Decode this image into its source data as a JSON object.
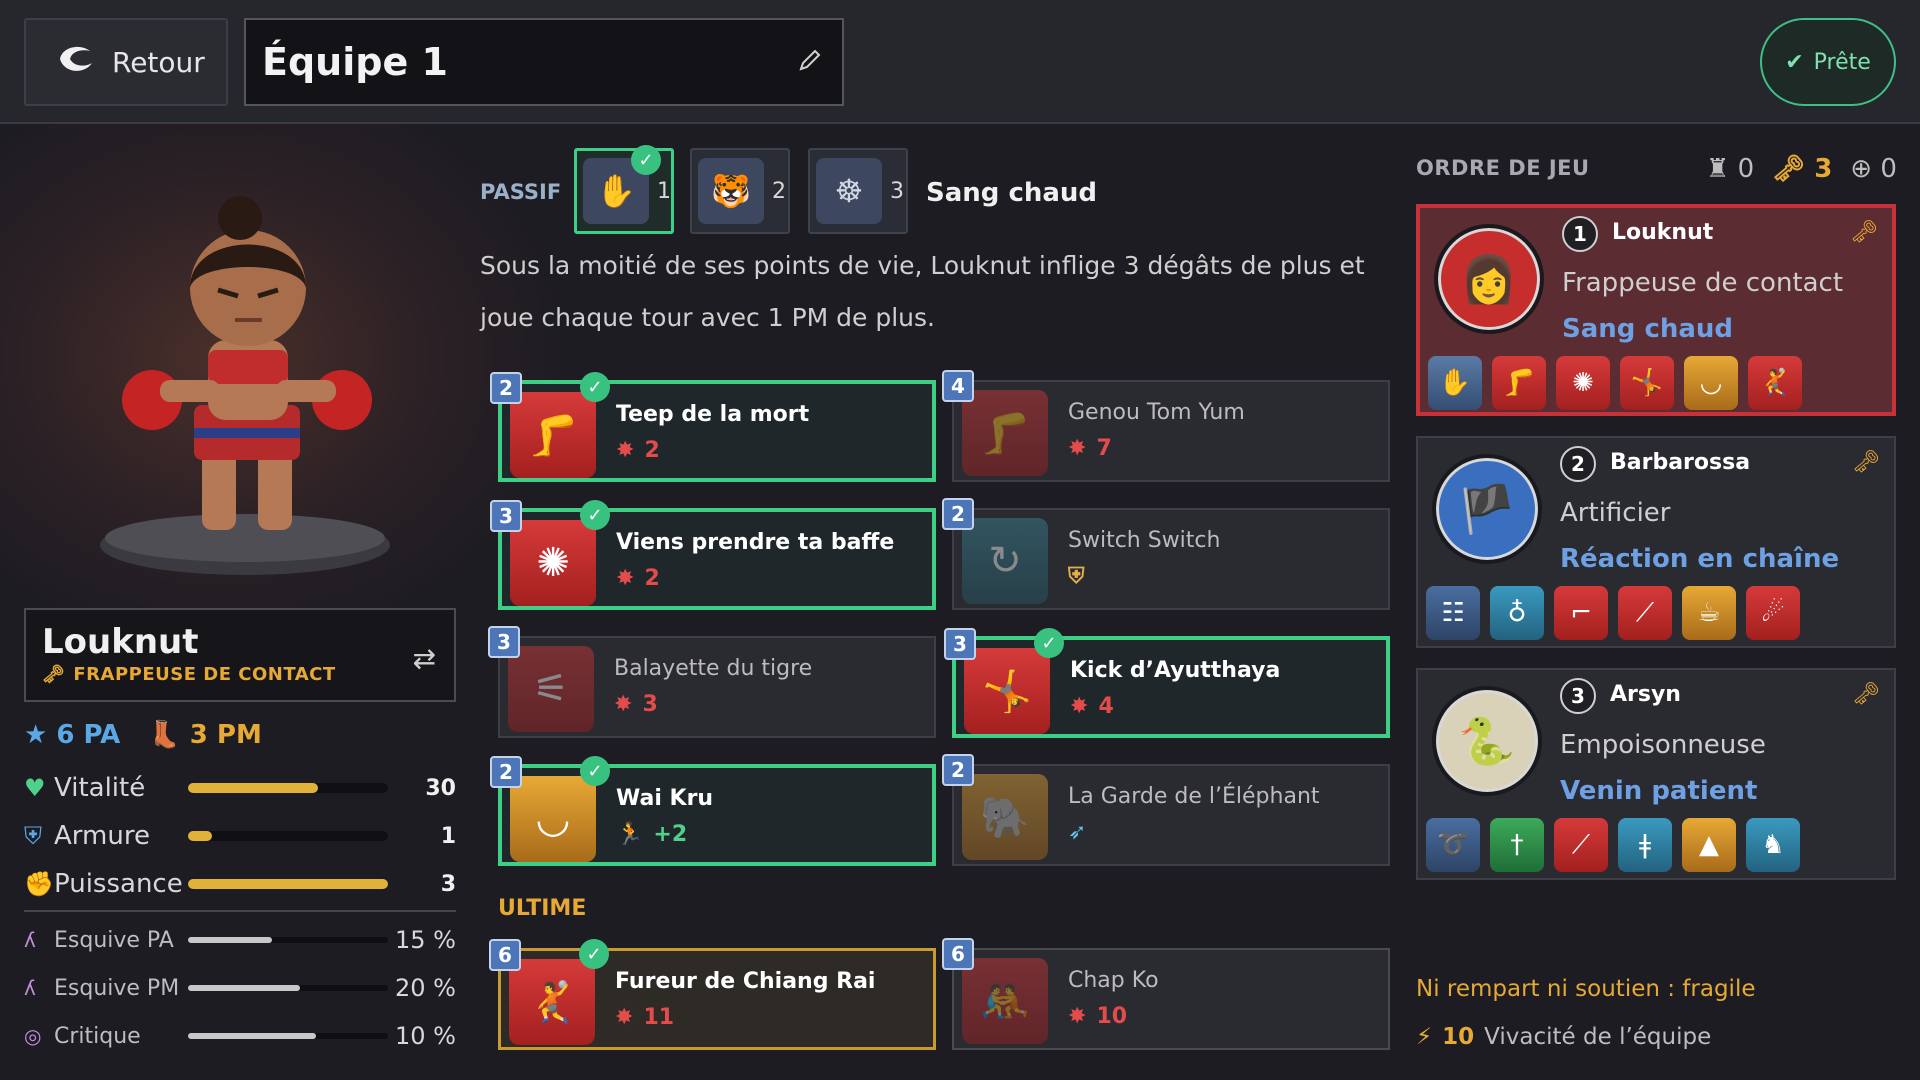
{
  "topbar": {
    "back_label": "Retour",
    "team_name": "Équipe 1",
    "ready_label": "Prête"
  },
  "character": {
    "name": "Louknut",
    "role": "FRAPPEUSE DE CONTACT",
    "pa": "6 PA",
    "pm": "3 PM",
    "stats": [
      {
        "label": "Vitalité",
        "value": "30",
        "level": 0.65,
        "color": "#4fd08d"
      },
      {
        "label": "Armure",
        "value": "1",
        "level": 0.12,
        "color": "#5aa8e6"
      },
      {
        "label": "Puissance",
        "value": "3",
        "level": 1.0,
        "color": "#e44c4c"
      }
    ],
    "substats": [
      {
        "label": "Esquive PA",
        "value": "15 %",
        "level": 0.42
      },
      {
        "label": "Esquive PM",
        "value": "20 %",
        "level": 0.56
      },
      {
        "label": "Critique",
        "value": "10 %",
        "level": 0.64
      }
    ]
  },
  "passive": {
    "label": "PASSIF",
    "options": [
      {
        "num": "1",
        "icon": "fist-wrap-icon"
      },
      {
        "num": "2",
        "icon": "tiger-icon"
      },
      {
        "num": "3",
        "icon": "octopus-icon"
      }
    ],
    "title": "Sang chaud",
    "description": "Sous la moitié de ses points de vie, Louknut inflige 3 dégâts de plus et joue chaque tour avec 1 PM de plus."
  },
  "spells": [
    {
      "name": "Teep de la mort",
      "cost": "2",
      "value": "2"
    },
    {
      "name": "Genou Tom Yum",
      "cost": "4",
      "value": "7"
    },
    {
      "name": "Viens prendre ta baffe",
      "cost": "3",
      "value": "2"
    },
    {
      "name": "Switch Switch",
      "cost": "2",
      "value": ""
    },
    {
      "name": "Balayette du tigre",
      "cost": "3",
      "value": "3"
    },
    {
      "name": "Kick d’Ayutthaya",
      "cost": "3",
      "value": "4"
    },
    {
      "name": "Wai Kru",
      "cost": "2",
      "value": "+2"
    },
    {
      "name": "La Garde de l’Éléphant",
      "cost": "2",
      "value": ""
    }
  ],
  "ultime": {
    "label": "ULTIME",
    "spells": [
      {
        "name": "Fureur de Chiang Rai",
        "cost": "6",
        "value": "11"
      },
      {
        "name": "Chap Ko",
        "cost": "6",
        "value": "10"
      }
    ]
  },
  "order": {
    "label": "ORDRE DE JEU",
    "count_tank": "0",
    "count_damage": "3",
    "count_support": "0",
    "members": [
      {
        "num": "1",
        "name": "Louknut",
        "role": "Frappeuse de contact",
        "passive": "Sang chaud"
      },
      {
        "num": "2",
        "name": "Barbarossa",
        "role": "Artificier",
        "passive": "Réaction en chaîne"
      },
      {
        "num": "3",
        "name": "Arsyn",
        "role": "Empoisonneuse",
        "passive": "Venin patient"
      }
    ]
  },
  "footer": {
    "warning": "Ni rempart ni soutien : fragile",
    "vivacite_value": "10",
    "vivacite_label": "Vivacité de l’équipe"
  },
  "colors": {
    "selected_green": "#3ccf85",
    "accent_gold": "#e7a935",
    "active_red": "#c6323a",
    "damage_red": "#e44c4c"
  }
}
